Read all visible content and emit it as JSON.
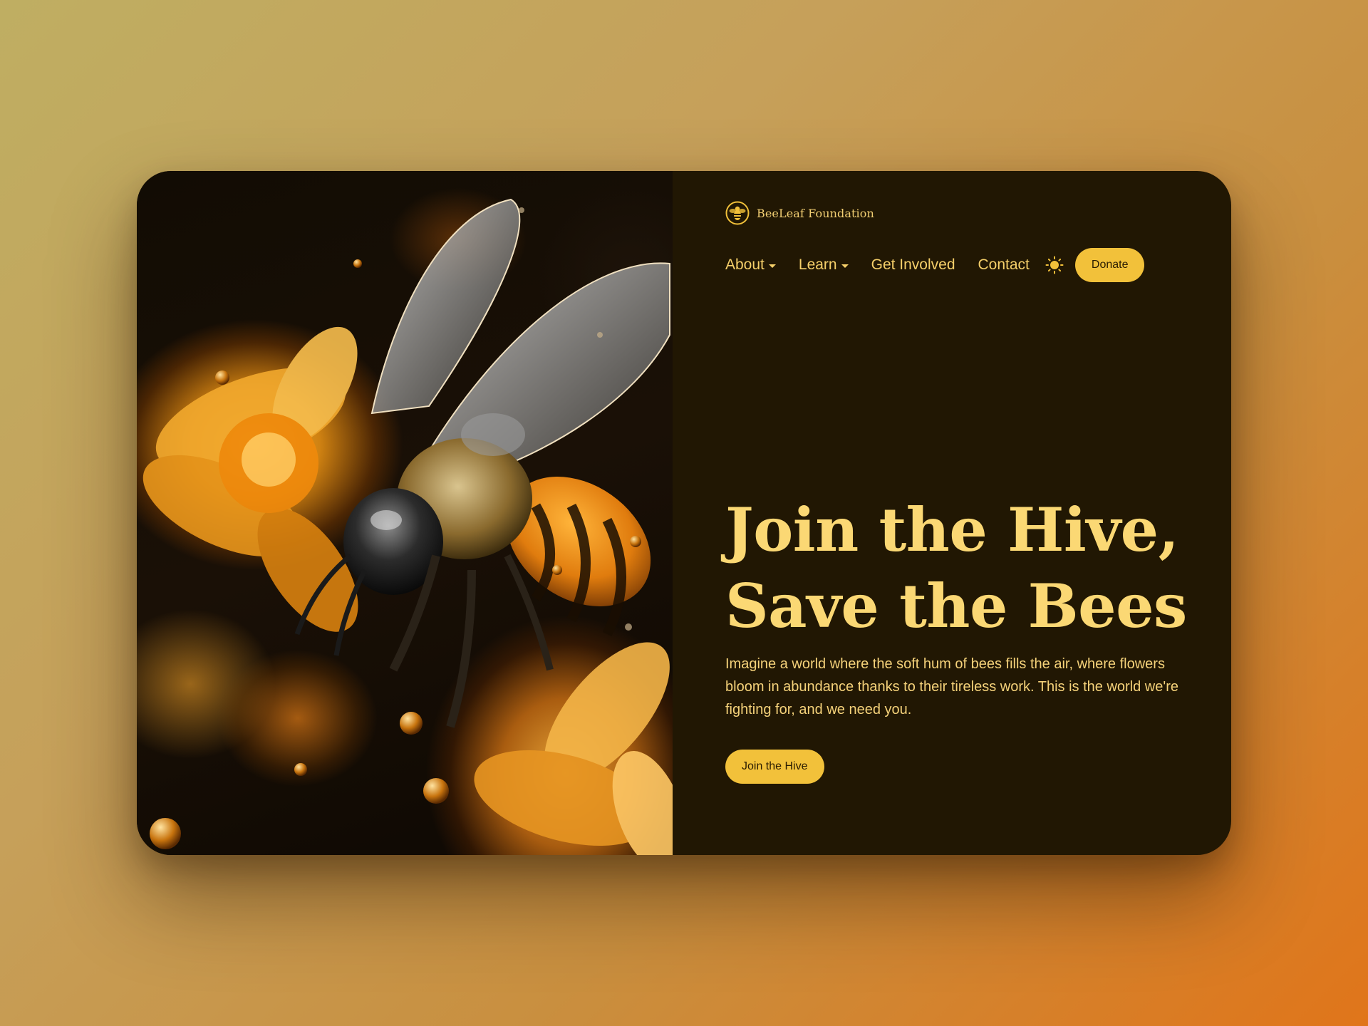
{
  "brand": {
    "name": "BeeLeaf Foundation",
    "logo_icon": "bee-emblem-icon"
  },
  "nav": {
    "items": [
      {
        "label": "About",
        "has_dropdown": true
      },
      {
        "label": "Learn",
        "has_dropdown": true
      },
      {
        "label": "Get Involved",
        "has_dropdown": false
      },
      {
        "label": "Contact",
        "has_dropdown": false
      }
    ],
    "theme_toggle_icon": "sun-icon",
    "donate_label": "Donate"
  },
  "hero": {
    "headline_line1": "Join the Hive,",
    "headline_line2": "Save the Bees",
    "body": "Imagine a world where the soft hum of bees fills the air, where flowers bloom in abundance thanks to their tireless work. This is the world we're fighting for, and we need you.",
    "cta_label": "Join the Hive",
    "image_subject": "honeybee-on-orange-flowers"
  },
  "colors": {
    "accent": "#f2c13a",
    "panel_background": "#211703",
    "text_gold": "#fbd874"
  }
}
